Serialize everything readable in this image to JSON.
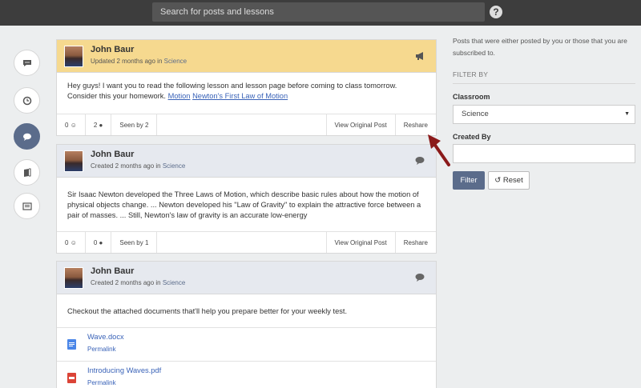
{
  "search": {
    "placeholder": "Search for posts and lessons"
  },
  "sidebar": {
    "icons": [
      "chat-bubble-icon",
      "clock-icon",
      "comment-icon",
      "book-icon",
      "newspaper-icon"
    ]
  },
  "posts": [
    {
      "author": "John Baur",
      "meta_prefix": "Updated 2 months ago in",
      "classroom": "Science",
      "body": "Hey guys! I want you to read the following lesson and lesson page before coming to class tomorrow. Consider this your homework.",
      "links": [
        "Motion",
        "Newton's First Law of Motion"
      ],
      "likes": "0",
      "comments": "2",
      "seen": "Seen by 2",
      "view_label": "View Original Post",
      "reshare_label": "Reshare"
    },
    {
      "author": "John Baur",
      "meta_prefix": "Created 2 months ago in",
      "classroom": "Science",
      "body": "Sir Isaac Newton developed the Three Laws of Motion, which describe basic rules about how the motion of physical objects change. ... Newton developed his \"Law of Gravity\" to explain the attractive force between a pair of masses. ... Still, Newton's law of gravity is an accurate low-energy",
      "likes": "0",
      "comments": "0",
      "seen": "Seen by 1",
      "view_label": "View Original Post",
      "reshare_label": "Reshare"
    },
    {
      "author": "John Baur",
      "meta_prefix": "Created 2 months ago in",
      "classroom": "Science",
      "body": "Checkout the attached documents that'll help you prepare better for your weekly test.",
      "attachments": [
        {
          "name": "Wave.docx",
          "link": "Permalink",
          "icon": "doc-icon"
        },
        {
          "name": "Introducing Waves.pdf",
          "link": "Permalink",
          "icon": "pdf-icon"
        }
      ]
    }
  ],
  "filter": {
    "description": "Posts that were either posted by you or those that you are subscribed to.",
    "title": "FILTER BY",
    "classroom_label": "Classroom",
    "classroom_value": "Science",
    "created_by_label": "Created By",
    "created_by_value": "",
    "filter_button": "Filter",
    "reset_button": "Reset"
  },
  "colors": {
    "accent": "#5b6c8b",
    "highlight": "#f6d98f",
    "link": "#3a63b8",
    "annotation_arrow": "#8b1a1a"
  }
}
